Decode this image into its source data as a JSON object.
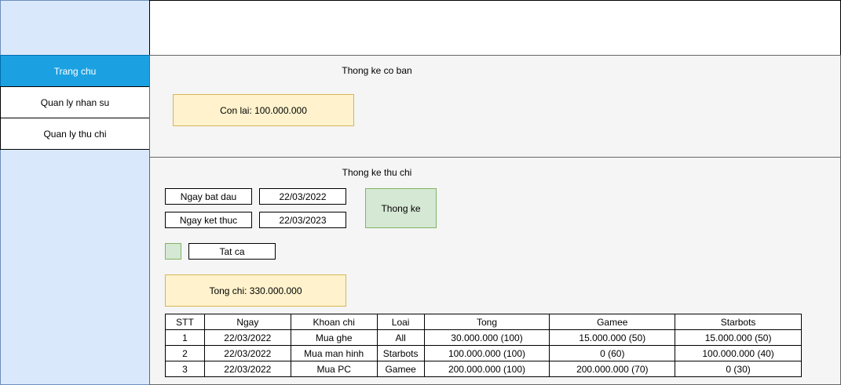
{
  "sidebar": {
    "items": [
      {
        "label": "Trang chu"
      },
      {
        "label": "Quan ly nhan su"
      },
      {
        "label": "Quan ly thu chi"
      }
    ]
  },
  "basic_stats": {
    "title": "Thong ke co ban",
    "remaining": "Con lai: 100.000.000"
  },
  "finance_stats": {
    "title": "Thong ke thu chi",
    "start_label": "Ngay bat dau",
    "start_value": "22/03/2022",
    "end_label": "Ngay ket thuc",
    "end_value": "22/03/2023",
    "submit_label": "Thong ke",
    "filter_label": "Tat ca",
    "total_spent": "Tong chi: 330.000.000"
  },
  "table": {
    "headers": [
      "STT",
      "Ngay",
      "Khoan chi",
      "Loai",
      "Tong",
      "Gamee",
      "Starbots"
    ],
    "rows": [
      [
        "1",
        "22/03/2022",
        "Mua ghe",
        "All",
        "30.000.000 (100)",
        "15.000.000 (50)",
        "15.000.000 (50)"
      ],
      [
        "2",
        "22/03/2022",
        "Mua man hinh",
        "Starbots",
        "100.000.000 (100)",
        "0 (60)",
        "100.000.000 (40)"
      ],
      [
        "3",
        "22/03/2022",
        "Mua PC",
        "Gamee",
        "200.000.000 (100)",
        "200.000.000 (70)",
        "0 (30)"
      ]
    ]
  }
}
